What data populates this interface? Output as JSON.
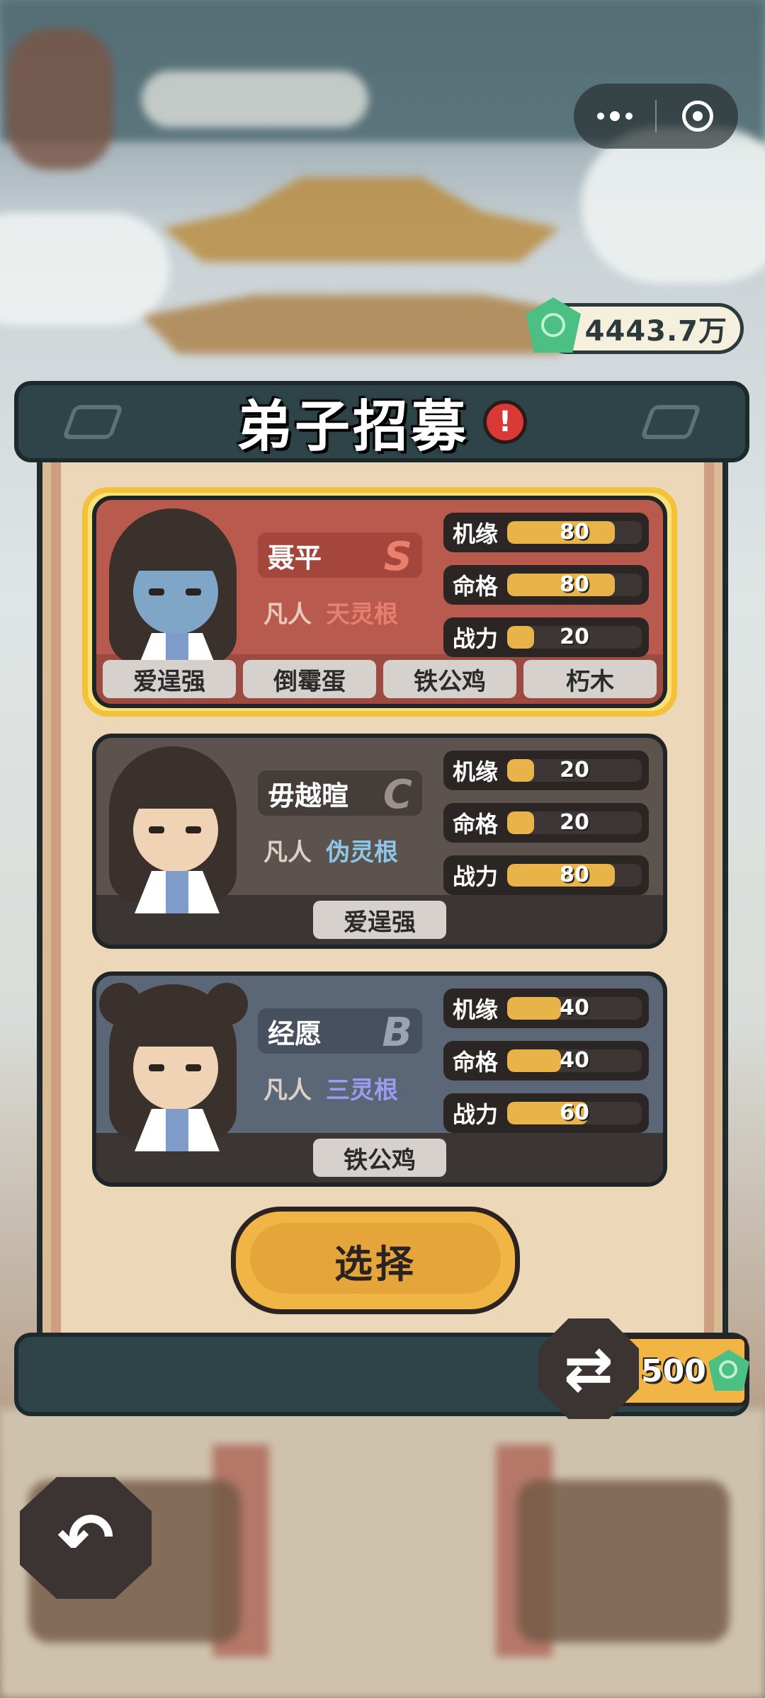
{
  "title": "弟子招募",
  "currency": {
    "amount": "4443.7万",
    "icon": "jade-gem-icon"
  },
  "recruits": [
    {
      "name": "聂平",
      "grade": "S",
      "grade_color": "#e87f6f",
      "realm": "凡人",
      "root": "天灵根",
      "root_color": "#e77f6e",
      "selected": true,
      "stats": [
        {
          "label": "机缘",
          "value": 80
        },
        {
          "label": "命格",
          "value": 80
        },
        {
          "label": "战力",
          "value": 20
        }
      ],
      "tags": [
        "爱逞强",
        "倒霉蛋",
        "铁公鸡",
        "朽木"
      ]
    },
    {
      "name": "毋越暄",
      "grade": "C",
      "grade_color": "#9a918c",
      "realm": "凡人",
      "root": "伪灵根",
      "root_color": "#8ec6e8",
      "selected": false,
      "stats": [
        {
          "label": "机缘",
          "value": 20
        },
        {
          "label": "命格",
          "value": 20
        },
        {
          "label": "战力",
          "value": 80
        }
      ],
      "tags": [
        "爱逞强"
      ]
    },
    {
      "name": "经愿",
      "grade": "B",
      "grade_color": "#9aa3b3",
      "realm": "凡人",
      "root": "三灵根",
      "root_color": "#9a9cef",
      "selected": false,
      "stats": [
        {
          "label": "机缘",
          "value": 40
        },
        {
          "label": "命格",
          "value": 40
        },
        {
          "label": "战力",
          "value": 60
        }
      ],
      "tags": [
        "铁公鸡"
      ]
    }
  ],
  "select_button": "选择",
  "refresh": {
    "cost": "500",
    "icon": "refresh-icon"
  },
  "back_icon": "back-arrow-icon",
  "colors": {
    "accent": "#f0b545",
    "panel": "#2e4448",
    "selected_frame": "#f4c13a"
  }
}
